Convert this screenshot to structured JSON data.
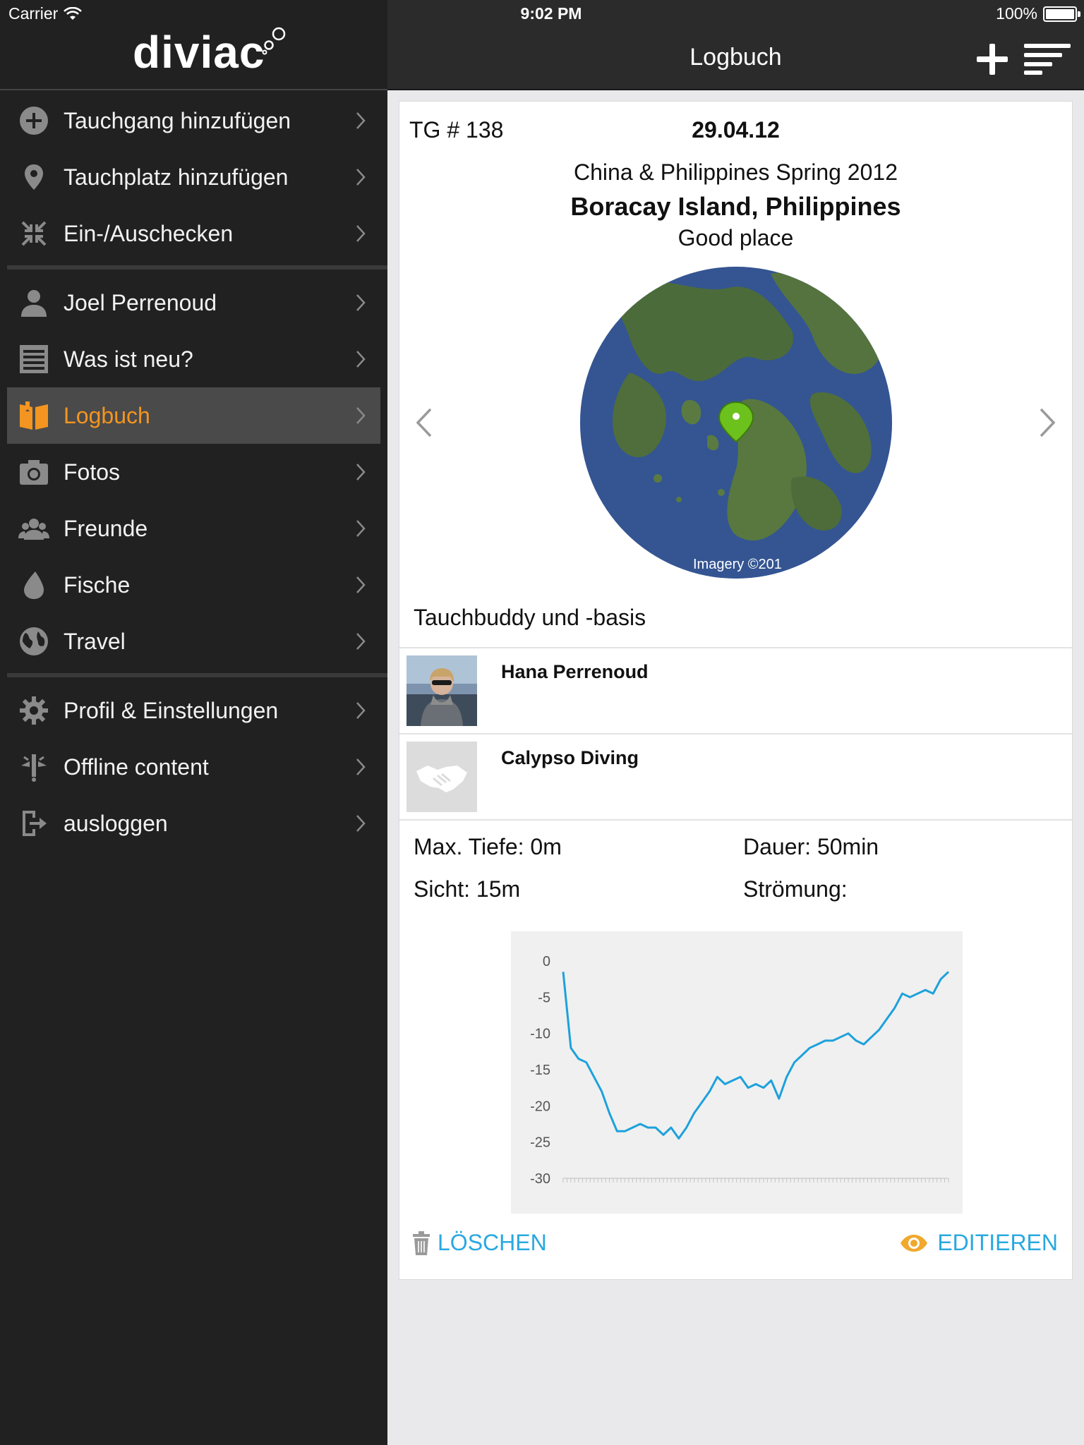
{
  "status_bar": {
    "carrier": "Carrier",
    "time": "9:02 PM",
    "battery": "100%"
  },
  "app": {
    "logo_text": "diviac"
  },
  "sidebar": {
    "groups": [
      {
        "items": [
          {
            "label": "Tauchgang hinzufügen",
            "icon": "plus-circle-icon"
          },
          {
            "label": "Tauchplatz hinzufügen",
            "icon": "location-pin-icon"
          },
          {
            "label": "Ein-/Auschecken",
            "icon": "collapse-arrows-icon"
          }
        ]
      },
      {
        "items": [
          {
            "label": "Joel Perrenoud",
            "icon": "user-icon"
          },
          {
            "label": "Was ist neu?",
            "icon": "news-list-icon"
          },
          {
            "label": "Logbuch",
            "icon": "logbook-icon",
            "active": true
          },
          {
            "label": "Fotos",
            "icon": "camera-icon"
          },
          {
            "label": "Freunde",
            "icon": "friends-icon"
          },
          {
            "label": "Fische",
            "icon": "drop-icon"
          },
          {
            "label": "Travel",
            "icon": "globe-icon"
          }
        ]
      },
      {
        "items": [
          {
            "label": "Profil & Einstellungen",
            "icon": "gear-icon"
          },
          {
            "label": "Offline content",
            "icon": "offline-antenna-icon"
          },
          {
            "label": "ausloggen",
            "icon": "logout-icon"
          }
        ]
      }
    ]
  },
  "navbar": {
    "title": "Logbuch",
    "add_icon": "plus-icon",
    "sort_icon": "sort-lines-icon"
  },
  "dive": {
    "number": "TG # 138",
    "date": "29.04.12",
    "trip": "China & Philippines Spring 2012",
    "site": "Boracay Island, Philippines",
    "comment": "Good place",
    "map_credit": "Imagery ©201",
    "section_title": "Tauchbuddy und -basis",
    "buddies": [
      {
        "name": "Hana Perrenoud"
      },
      {
        "name": "Calypso Diving"
      }
    ],
    "stats": {
      "max_depth": "Max. Tiefe: 0m",
      "duration": "Dauer: 50min",
      "visibility": "Sicht: 15m",
      "current": "Strömung:"
    },
    "actions": {
      "delete": "LÖSCHEN",
      "edit": "EDITIEREN"
    }
  },
  "colors": {
    "accent": "#f39520",
    "link": "#29a8e0",
    "chart_line": "#1da1dc",
    "sidebar_bg": "#212121"
  },
  "chart_data": {
    "type": "line",
    "title": "",
    "xlabel": "",
    "ylabel": "",
    "ylim": [
      -30,
      0
    ],
    "yticks": [
      0,
      -5,
      -10,
      -15,
      -20,
      -25,
      -30
    ],
    "x": [
      0,
      1,
      2,
      3,
      4,
      5,
      6,
      7,
      8,
      9,
      10,
      11,
      12,
      13,
      14,
      15,
      16,
      17,
      18,
      19,
      20,
      21,
      22,
      23,
      24,
      25,
      26,
      27,
      28,
      29,
      30,
      31,
      32,
      33,
      34,
      35,
      36,
      37,
      38,
      39,
      40,
      41,
      42,
      43,
      44,
      45,
      46,
      47,
      48,
      49,
      50
    ],
    "series": [
      {
        "values": [
          -1.5,
          -12,
          -13.5,
          -14,
          -16,
          -18,
          -21,
          -23.5,
          -23.5,
          -23,
          -22.5,
          -23,
          -23,
          -24,
          -23,
          -24.5,
          -23,
          -21,
          -19.5,
          -18,
          -16,
          -17,
          -16.5,
          -16,
          -17.5,
          -17,
          -17.5,
          -16.5,
          -19,
          -16,
          -14,
          -13,
          -12,
          -11.5,
          -11,
          -11,
          -10.5,
          -10,
          -11,
          -11.5,
          -10.5,
          -9.5,
          -8,
          -6.5,
          -4.5,
          -5,
          -4.5,
          -4,
          -4.5,
          -2.5,
          -1.5
        ]
      }
    ]
  }
}
